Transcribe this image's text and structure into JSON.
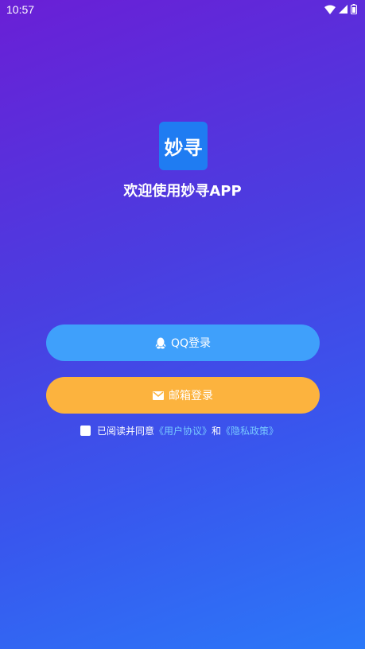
{
  "status_bar": {
    "time": "10:57",
    "icons": [
      "wifi-icon",
      "signal-icon",
      "battery-icon"
    ]
  },
  "app": {
    "logo_text": "妙寻",
    "welcome": "欢迎使用妙寻APP"
  },
  "buttons": {
    "qq_label": "QQ登录",
    "email_label": "邮箱登录"
  },
  "agreement": {
    "checked": false,
    "prefix": "已阅读并同意",
    "user_agreement": "《用户协议》",
    "conjunction": "和",
    "privacy_policy": "《隐私政策》"
  },
  "colors": {
    "qq_button": "#3fa0fb",
    "email_button": "#fcb33e",
    "logo_bg": "#1f7cf2",
    "link": "#78c9ff"
  }
}
